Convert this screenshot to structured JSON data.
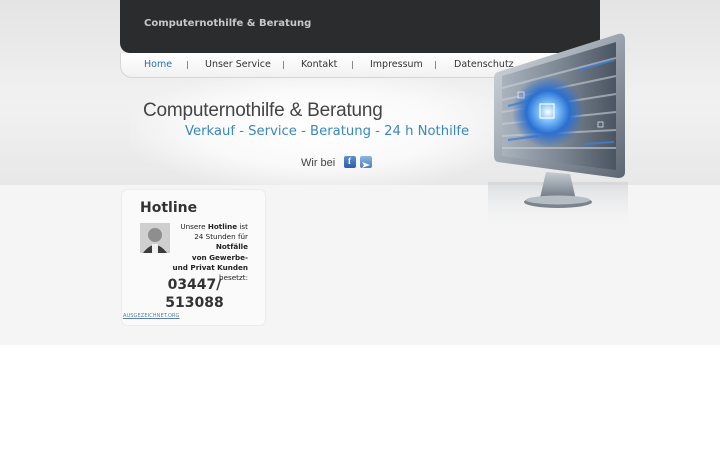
{
  "header": {
    "site_name": "Computernothilfe & Beratung"
  },
  "nav": {
    "items": [
      {
        "label": "Home",
        "active": true
      },
      {
        "label": "Unser Service"
      },
      {
        "label": "Kontakt"
      },
      {
        "label": "Impressum"
      },
      {
        "label": "Datenschutz"
      }
    ],
    "separator": "|"
  },
  "hero": {
    "title": "Computernothilfe & Beratung",
    "subtitle": "Verkauf - Service - Beratung - 24 h Nothilfe",
    "social_label": "Wir bei",
    "facebook_letter": "f"
  },
  "hotline": {
    "title": "Hotline",
    "text": {
      "line1_a": "Unsere ",
      "line1_b": "Hotline",
      "line1_c": " ist",
      "line2": "24 Stunden für",
      "line3": "Notfälle",
      "line4": "von Gewerbe-",
      "line5_a": "und Privat Kunden",
      "line5_b": " besetzt:"
    },
    "phone_line1": "03447/",
    "phone_line2": "513088",
    "badge_link": "AUSGEZEICHNET.ORG"
  },
  "colors": {
    "accent_blue": "#3a88c2",
    "nav_active": "#2a6fb5",
    "header_dark": "#2b2c2e"
  },
  "icons": [
    "facebook-icon",
    "share-icon",
    "monitor-graphic"
  ]
}
